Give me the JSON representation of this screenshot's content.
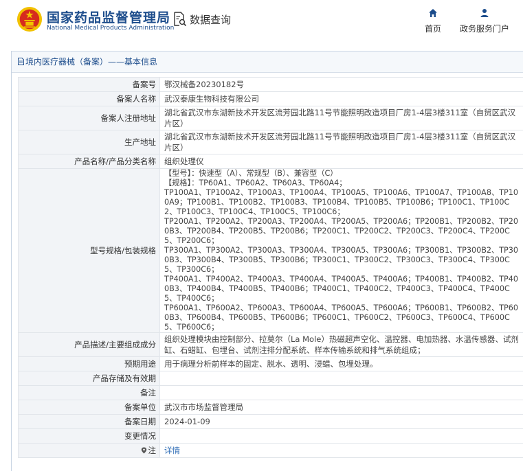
{
  "header": {
    "org_name_cn": "国家药品监督管理局",
    "org_name_en": "National Medical Products Administration",
    "section_title": "数据查询",
    "nav": {
      "home": "首页",
      "portal": "政务服务门户"
    }
  },
  "panel": {
    "title": "境内医疗器械（备案）——基本信息"
  },
  "record": {
    "rows": [
      {
        "label": "备案号",
        "value": "鄂汉械备20230182号"
      },
      {
        "label": "备案人名称",
        "value": "武汉泰康生物科技有限公司"
      },
      {
        "label": "备案人注册地址",
        "value": "湖北省武汉市东湖新技术开发区流芳园北路11号节能照明改造项目厂房1-4层3楼311室（自贸区武汉片区）"
      },
      {
        "label": "生产地址",
        "value": "湖北省武汉市东湖新技术开发区流芳园北路11号节能照明改造项目厂房1-4层3楼311室（自贸区武汉片区）"
      },
      {
        "label": "产品名称/产品分类名称",
        "value": "组织处理仪"
      },
      {
        "label": "型号规格/包装规格",
        "value": "【型号】：快速型（A）、常规型（B）、兼容型（C）\n【规格】：TP60A1、TP60A2、TP60A3、TP60A4；\nTP100A1、TP100A2、TP100A3、TP100A4、TP100A5、TP100A6、TP100A7、TP100A8、TP100A9；TP100B1、TP100B2、TP100B3、TP100B4、TP100B5、TP100B6；TP100C1、TP100C2、TP100C3、TP100C4、TP100C5、TP100C6；\nTP200A1、TP200A2、TP200A3、TP200A4、TP200A5、TP200A6；TP200B1、TP200B2、TP200B3、TP200B4、TP200B5、TP200B6；TP200C1、TP200C2、TP200C3、TP200C4、TP200C5、TP200C6；\nTP300A1、TP300A2、TP300A3、TP300A4、TP300A5、TP300A6；TP300B1、TP300B2、TP300B3、TP300B4、TP300B5、TP300B6；TP300C1、TP300C2、TP300C3、TP300C4、TP300C5、TP300C6；\nTP400A1、TP400A2、TP400A3、TP400A4、TP400A5、TP400A6；TP400B1、TP400B2、TP400B3、TP400B4、TP400B5、TP400B6；TP400C1、TP400C2、TP400C3、TP400C4、TP400C5、TP400C6；\nTP600A1、TP600A2、TP600A3、TP600A4、TP600A5、TP600A6；TP600B1、TP600B2、TP600B3、TP600B4、TP600B5、TP600B6；TP600C1、TP600C2、TP600C3、TP600C4、TP600C5、TP600C6；"
      },
      {
        "label": "产品描述/主要组成成分",
        "value": "组织处理模块由控制部分、拉莫尔（La Mole）热磁超声空化、温控器、电加热器、水温传感器、试剂缸、石蜡缸、包埋台、试剂注排分配系统、样本传输系统和排气系统组成；"
      },
      {
        "label": "预期用途",
        "value": "用于病理分析前样本的固定、脱水、透明、浸蜡、包埋处理。"
      },
      {
        "label": "产品存储及有效期",
        "value": ""
      },
      {
        "label": "备注",
        "value": ""
      },
      {
        "label": "备案单位",
        "value": "武汉市市场监督管理局"
      },
      {
        "label": "备案日期",
        "value": "2024-01-09"
      },
      {
        "label": "变更情况",
        "value": ""
      },
      {
        "label": "注",
        "value": "详情"
      }
    ]
  },
  "icons": {
    "logo": "national-emblem-icon",
    "search": "document-search-icon",
    "home": "home-icon",
    "portal": "user-icon",
    "title": "document-icon",
    "note": "map-pin-icon"
  },
  "colors": {
    "brand": "#1d4d8c",
    "link": "#2a6ab4",
    "label_bg": "#f2f4f7",
    "emblem_red": "#d62a1e",
    "emblem_gold": "#f2c200"
  }
}
